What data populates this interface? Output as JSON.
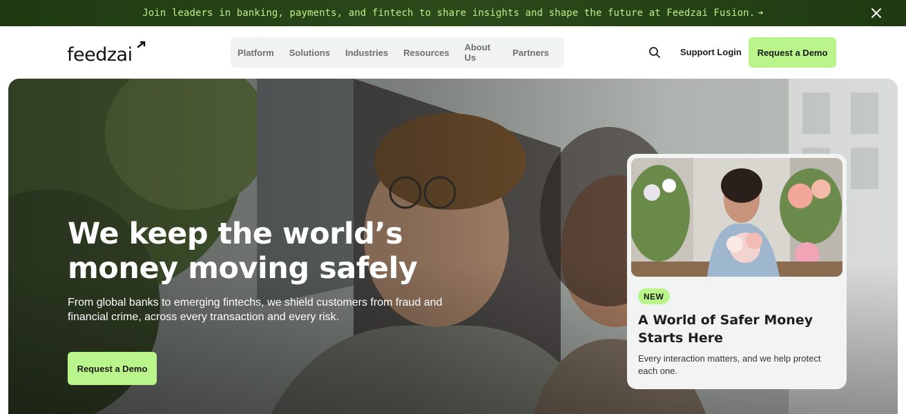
{
  "announcement": {
    "text": "Join leaders in banking, payments, and fintech to share insights and shape the future at Feedzai Fusion.",
    "arrow": "➔"
  },
  "nav": {
    "logo_text": "feedzai",
    "items": [
      {
        "label": "Platform"
      },
      {
        "label": "Solutions"
      },
      {
        "label": "Industries"
      },
      {
        "label": "Resources"
      },
      {
        "label": "About Us"
      },
      {
        "label": "Partners"
      }
    ],
    "support_login": "Support Login",
    "request_demo": "Request a Demo"
  },
  "hero": {
    "headline": "We keep the world’s money moving safely",
    "subtext": "From global banks to emerging fintechs, we shield customers from fraud and financial crime, across every transaction and every risk.",
    "cta": "Request a Demo"
  },
  "card": {
    "badge": "NEW",
    "title": "A World of Safer Money Starts Here",
    "description": "Every interaction matters, and we help protect each one."
  },
  "colors": {
    "accent": "#b9f58a",
    "announce_bg": "#2c4a1a",
    "announce_text": "#b9f08a"
  }
}
